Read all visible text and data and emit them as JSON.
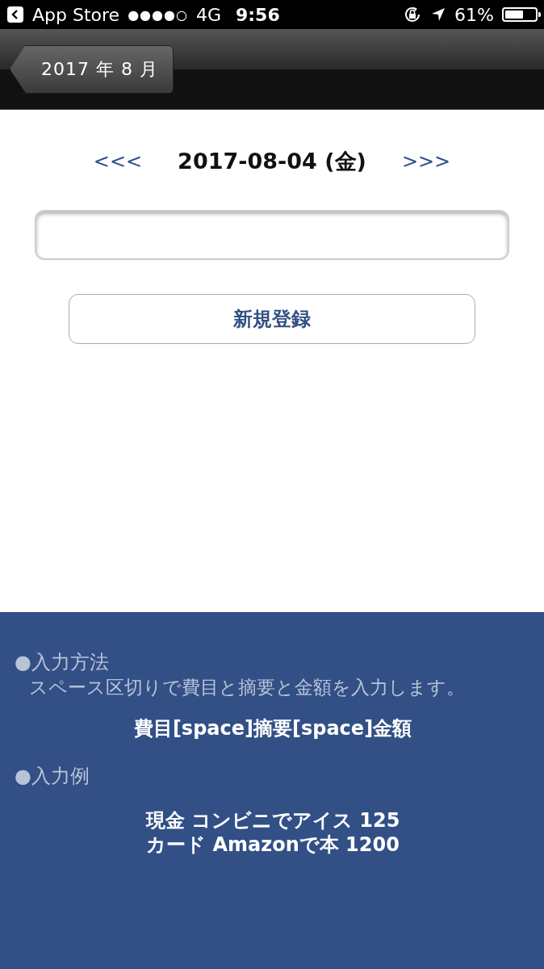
{
  "status_bar": {
    "back_app": "App Store",
    "signal": "●●●●○",
    "network": "4G",
    "time": "9:56",
    "battery": "61%"
  },
  "nav_bar": {
    "back_button": "2017 年 8 月"
  },
  "date_nav": {
    "prev": "<<<",
    "date": "2017-08-04 (金)",
    "next": ">>>"
  },
  "register_button": "新規登録",
  "help": {
    "sections": [
      {
        "heading": "●入力方法",
        "lines": [
          {
            "kind": "note",
            "text": "スペース区切りで費目と摘要と金額を入力します。"
          },
          {
            "kind": "sample",
            "text": "費目[space]摘要[space]金額"
          }
        ]
      },
      {
        "heading": "●入力例",
        "lines": [
          {
            "kind": "sample",
            "text": "現金 コンビニでアイス 125"
          },
          {
            "kind": "sample",
            "text": "カード Amazonで本 1200"
          }
        ]
      }
    ]
  }
}
